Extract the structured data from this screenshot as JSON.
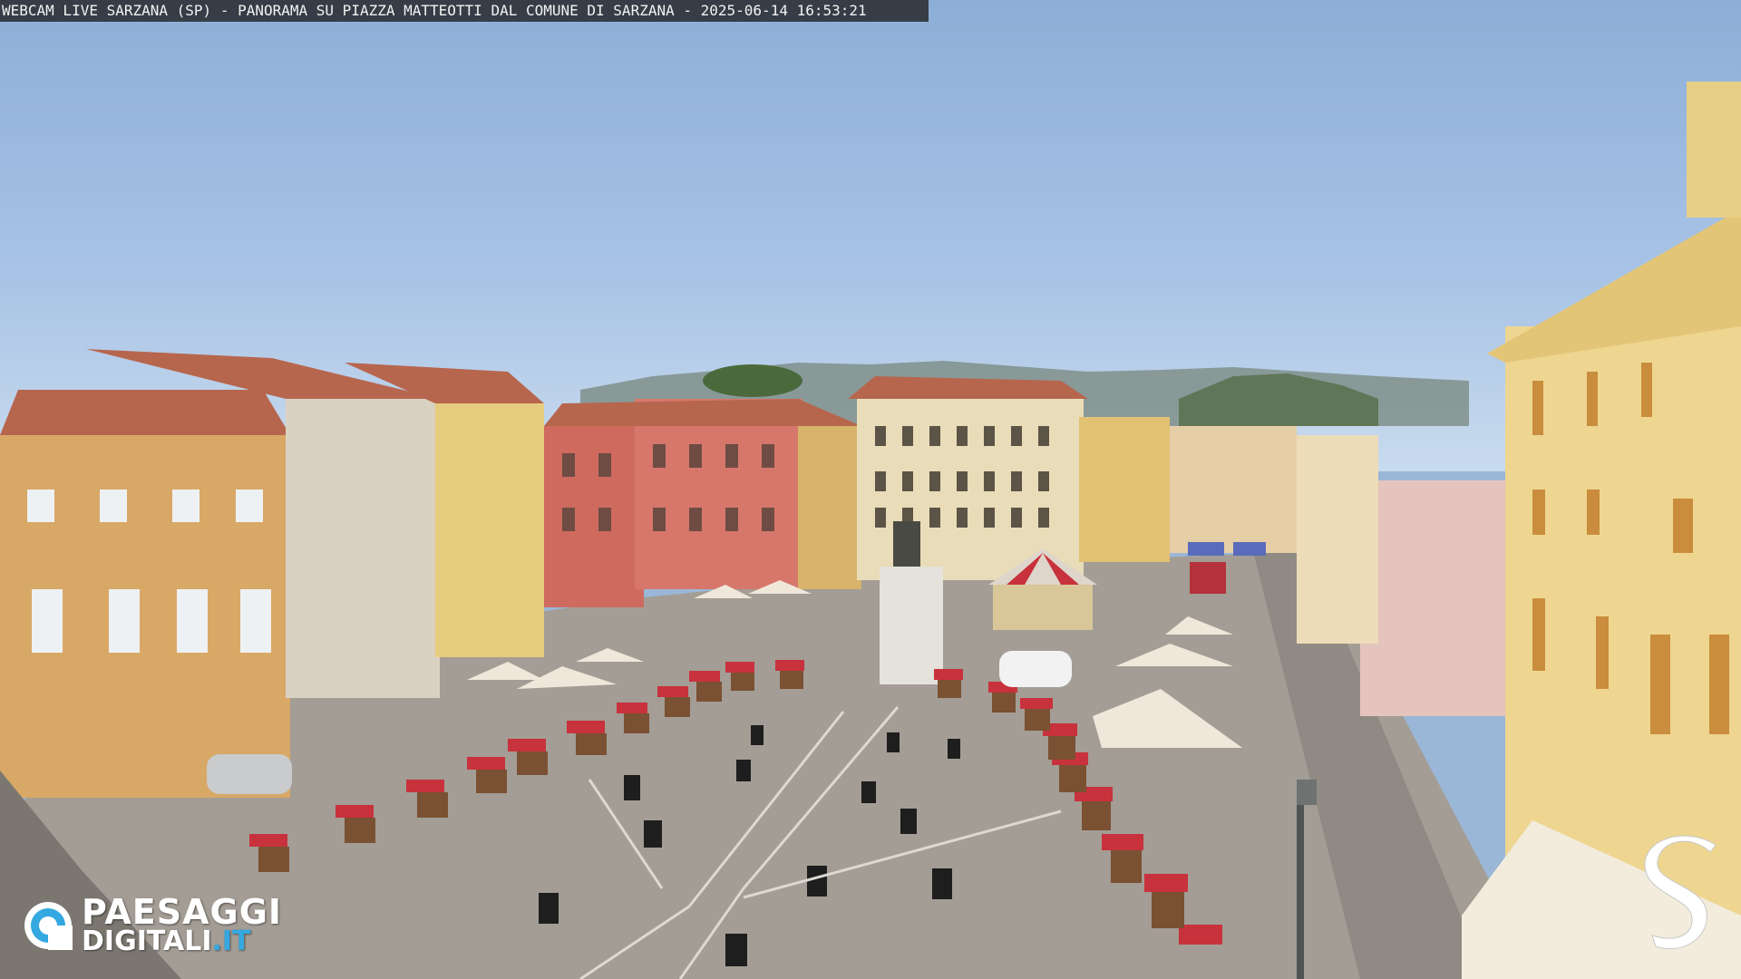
{
  "overlay": {
    "title": "WEBCAM LIVE SARZANA (SP) - PANORAMA SU PIAZZA MATTEOTTI DAL COMUNE DI SARZANA - 2025-06-14  16:53:21"
  },
  "branding": {
    "logo_line1": "PAESAGGI",
    "logo_line2_main": "DIGITALI",
    "logo_line2_tld": ".IT",
    "corner_icon": "s-logo-icon",
    "logo_icon": "eye-icon",
    "accent_color": "#34a8e0"
  },
  "scene": {
    "sky_color": "#9bb7d8",
    "colors": {
      "ochre": "#d8a866",
      "yellow": "#e6cc7e",
      "red": "#cf6a5e",
      "cream": "#e9dcb8",
      "roof": "#b7664e",
      "pavement": "#a39d95",
      "umbrella": "#efe8da",
      "stall_red": "#c8323c"
    }
  }
}
